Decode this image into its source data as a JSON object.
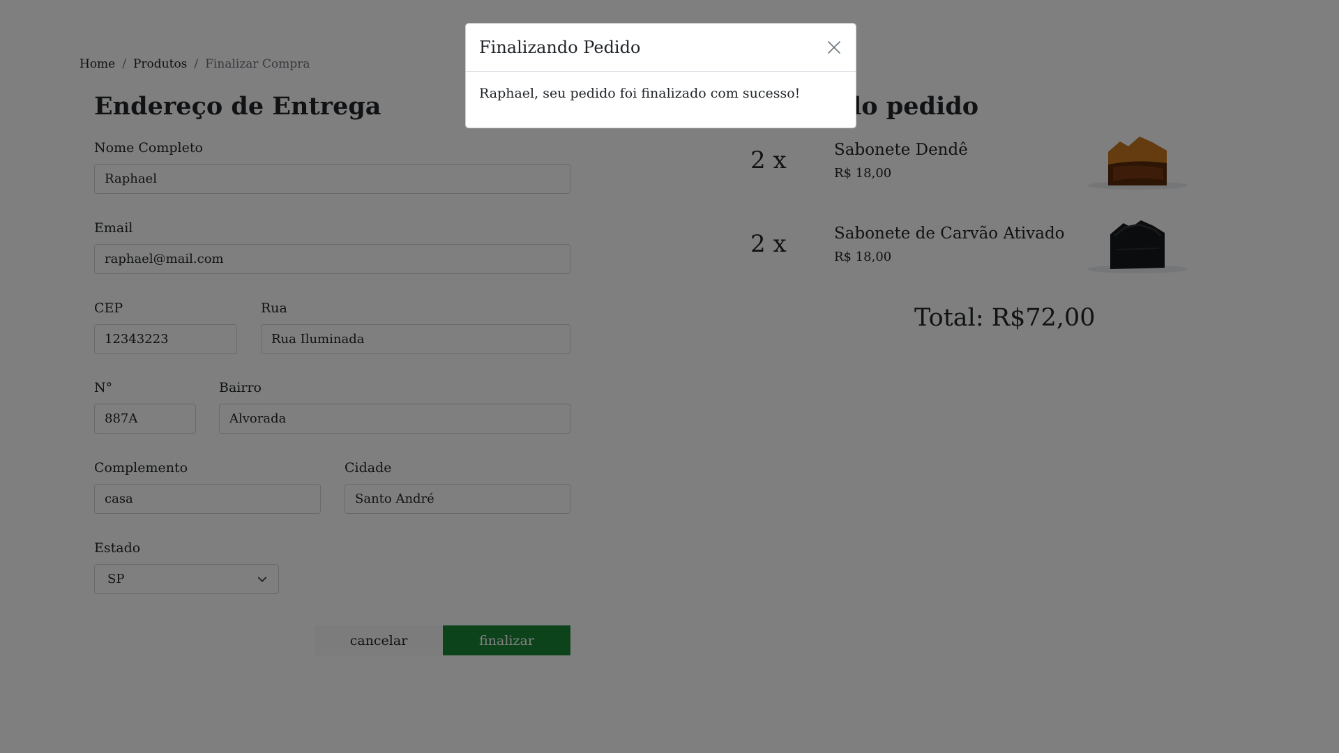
{
  "breadcrumb": {
    "items": [
      "Home",
      "Produtos",
      "Finalizar Compra"
    ],
    "separator": "/"
  },
  "shipping": {
    "title": "Endereço de Entrega",
    "fields": {
      "nome": {
        "label": "Nome Completo",
        "value": "Raphael"
      },
      "email": {
        "label": "Email",
        "value": "raphael@mail.com"
      },
      "cep": {
        "label": "CEP",
        "value": "12343223"
      },
      "rua": {
        "label": "Rua",
        "value": "Rua Iluminada"
      },
      "numero": {
        "label": "N°",
        "value": "887A"
      },
      "bairro": {
        "label": "Bairro",
        "value": "Alvorada"
      },
      "complemento": {
        "label": "Complemento",
        "value": "casa"
      },
      "cidade": {
        "label": "Cidade",
        "value": "Santo André"
      },
      "estado": {
        "label": "Estado",
        "value": "SP"
      }
    },
    "buttons": {
      "cancel": "cancelar",
      "finish": "finalizar"
    }
  },
  "summary": {
    "title_visible": "lo pedido",
    "items": [
      {
        "qty": "2 x",
        "name": "Sabonete Dendê",
        "price": "R$ 18,00",
        "image_icon": "soap-dende-image"
      },
      {
        "qty": "2 x",
        "name": "Sabonete de Carvão Ativado",
        "price": "R$ 18,00",
        "image_icon": "soap-carvao-image"
      }
    ],
    "total": "Total: R$72,00"
  },
  "modal": {
    "title": "Finalizando Pedido",
    "message": "Raphael, seu pedido foi finalizado com sucesso!",
    "close_icon": "close-icon"
  },
  "colors": {
    "finish_button": "#198737",
    "backdrop": "rgba(0,0,0,0.5)"
  }
}
